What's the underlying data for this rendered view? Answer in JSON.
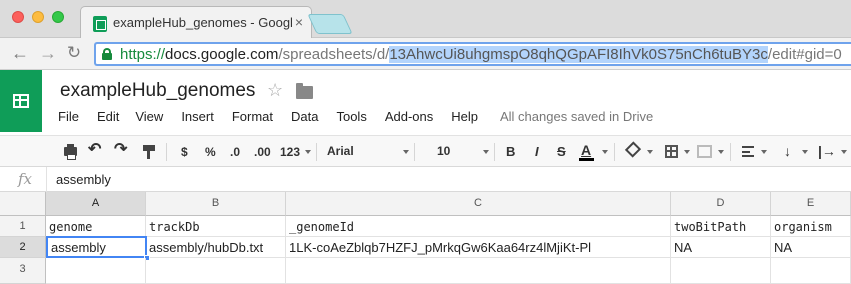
{
  "browser": {
    "tab_title": "exampleHub_genomes - Google Sheets",
    "tab_close": "×",
    "url": {
      "scheme": "https://",
      "host": "docs.google.com",
      "path_prefix": "/spreadsheets/d/",
      "doc_id": "13AhwcUi8uhgmspO8qhQGpAFI8IhVk0S75nCh6tuBY3c",
      "path_suffix": "/edit#gid=0"
    },
    "back": "←",
    "forward": "→",
    "reload": "↻"
  },
  "doc": {
    "title": "exampleHub_genomes",
    "star": "☆",
    "menu": [
      "File",
      "Edit",
      "View",
      "Insert",
      "Format",
      "Data",
      "Tools",
      "Add-ons",
      "Help"
    ],
    "save_status": "All changes saved in Drive"
  },
  "toolbar": {
    "undo": "↶",
    "redo": "↷",
    "currency": "$",
    "percent": "%",
    "decrease_decimals": ".0",
    "increase_decimals": ".00",
    "more_formats": "123",
    "font": "Arial",
    "font_size": "10",
    "bold": "B",
    "italic": "I",
    "strikethrough": "S",
    "text_color": "A",
    "valign": "↓",
    "wrap": "|→"
  },
  "formula_bar": {
    "fx": "fx",
    "value": "assembly"
  },
  "grid": {
    "columns": [
      "A",
      "B",
      "C",
      "D",
      "E"
    ],
    "rows": [
      "1",
      "2",
      "3"
    ],
    "cells": {
      "A1": "genome",
      "B1": "trackDb",
      "C1": "_genomeId",
      "D1": "twoBitPath",
      "E1": "organism",
      "A2": "assembly",
      "B2": "assembly/hubDb.txt",
      "C2": "1LK-coAeZblqb7HZFJ_pMrkqGw6Kaa64rz4lMjiKt-Pl",
      "D2": "NA",
      "E2": "NA"
    },
    "active_cell": "A2"
  },
  "colors": {
    "sheets_green": "#0f9d58",
    "selection_blue": "#4285f4",
    "url_highlight": "#b3d4fc",
    "secure_green": "#168a3c"
  }
}
